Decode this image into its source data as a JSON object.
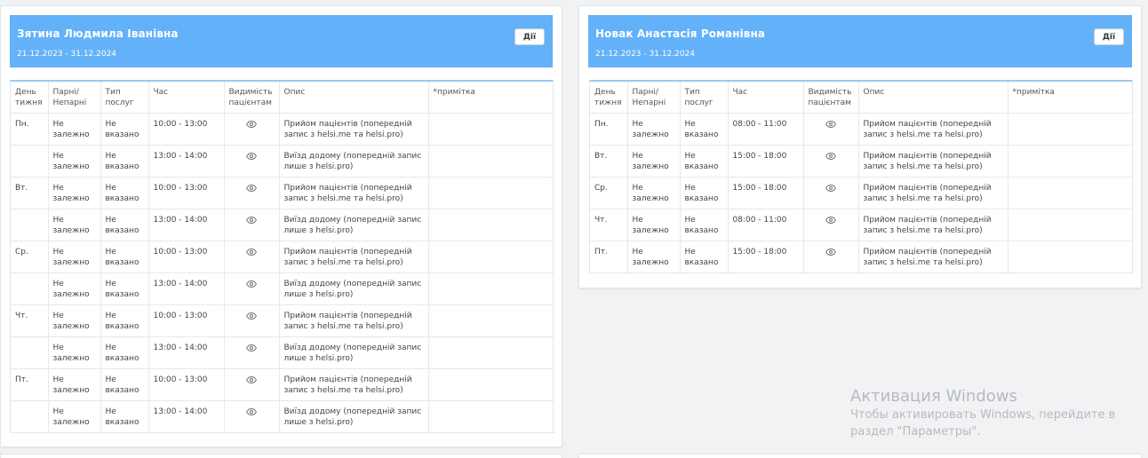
{
  "actions_label": "Дії",
  "eye_icon": "eye-icon",
  "columns": {
    "day": [
      "День",
      "тижня"
    ],
    "parity": [
      "Парні/",
      "Непарні"
    ],
    "service": [
      "Тип",
      "послуг"
    ],
    "time": "Час",
    "visibility": [
      "Видимість",
      "пацієнтам"
    ],
    "description": "Опис",
    "note": "*примітка"
  },
  "cards": [
    {
      "name": "Зятина Людмила Іванівна",
      "dates": "21.12.2023 - 31.12.2024",
      "rows": [
        {
          "day": "Пн.",
          "parity": [
            "Не",
            "залежно"
          ],
          "service": [
            "Не",
            "вказано"
          ],
          "time": "10:00 - 13:00",
          "desc": [
            "Прийом пацієнтів (попередній",
            "запис з helsi.me та helsi.pro)"
          ],
          "note": ""
        },
        {
          "day": "",
          "parity": [
            "Не",
            "залежно"
          ],
          "service": [
            "Не",
            "вказано"
          ],
          "time": "13:00 - 14:00",
          "desc": [
            "Виїзд додому (попередній запис",
            "лише з helsi.pro)"
          ],
          "note": ""
        },
        {
          "day": "Вт.",
          "parity": [
            "Не",
            "залежно"
          ],
          "service": [
            "Не",
            "вказано"
          ],
          "time": "10:00 - 13:00",
          "desc": [
            "Прийом пацієнтів (попередній",
            "запис з helsi.me та helsi.pro)"
          ],
          "note": ""
        },
        {
          "day": "",
          "parity": [
            "Не",
            "залежно"
          ],
          "service": [
            "Не",
            "вказано"
          ],
          "time": "13:00 - 14:00",
          "desc": [
            "Виїзд додому (попередній запис",
            "лише з helsi.pro)"
          ],
          "note": ""
        },
        {
          "day": "Ср.",
          "parity": [
            "Не",
            "залежно"
          ],
          "service": [
            "Не",
            "вказано"
          ],
          "time": "10:00 - 13:00",
          "desc": [
            "Прийом пацієнтів (попередній",
            "запис з helsi.me та helsi.pro)"
          ],
          "note": ""
        },
        {
          "day": "",
          "parity": [
            "Не",
            "залежно"
          ],
          "service": [
            "Не",
            "вказано"
          ],
          "time": "13:00 - 14:00",
          "desc": [
            "Виїзд додому (попередній запис",
            "лише з helsi.pro)"
          ],
          "note": ""
        },
        {
          "day": "Чт.",
          "parity": [
            "Не",
            "залежно"
          ],
          "service": [
            "Не",
            "вказано"
          ],
          "time": "10:00 - 13:00",
          "desc": [
            "Прийом пацієнтів (попередній",
            "запис з helsi.me та helsi.pro)"
          ],
          "note": ""
        },
        {
          "day": "",
          "parity": [
            "Не",
            "залежно"
          ],
          "service": [
            "Не",
            "вказано"
          ],
          "time": "13:00 - 14:00",
          "desc": [
            "Виїзд додому (попередній запис",
            "лише з helsi.pro)"
          ],
          "note": ""
        },
        {
          "day": "Пт.",
          "parity": [
            "Не",
            "залежно"
          ],
          "service": [
            "Не",
            "вказано"
          ],
          "time": "10:00 - 13:00",
          "desc": [
            "Прийом пацієнтів (попередній",
            "запис з helsi.me та helsi.pro)"
          ],
          "note": ""
        },
        {
          "day": "",
          "parity": [
            "Не",
            "залежно"
          ],
          "service": [
            "Не",
            "вказано"
          ],
          "time": "13:00 - 14:00",
          "desc": [
            "Виїзд додому (попередній запис",
            "лише з helsi.pro)"
          ],
          "note": ""
        }
      ]
    },
    {
      "name": "Новак Анастасія Романівна",
      "dates": "21.12.2023 - 31.12.2024",
      "rows": [
        {
          "day": "Пн.",
          "parity": [
            "Не",
            "залежно"
          ],
          "service": [
            "Не",
            "вказано"
          ],
          "time": "08:00 - 11:00",
          "desc": [
            "Прийом пацієнтів (попередній",
            "запис з helsi.me та helsi.pro)"
          ],
          "note": ""
        },
        {
          "day": "Вт.",
          "parity": [
            "Не",
            "залежно"
          ],
          "service": [
            "Не",
            "вказано"
          ],
          "time": "15:00 - 18:00",
          "desc": [
            "Прийом пацієнтів (попередній",
            "запис з helsi.me та helsi.pro)"
          ],
          "note": ""
        },
        {
          "day": "Ср.",
          "parity": [
            "Не",
            "залежно"
          ],
          "service": [
            "Не",
            "вказано"
          ],
          "time": "15:00 - 18:00",
          "desc": [
            "Прийом пацієнтів (попередній",
            "запис з helsi.me та helsi.pro)"
          ],
          "note": ""
        },
        {
          "day": "Чт.",
          "parity": [
            "Не",
            "залежно"
          ],
          "service": [
            "Не",
            "вказано"
          ],
          "time": "08:00 - 11:00",
          "desc": [
            "Прийом пацієнтів (попередній",
            "запис з helsi.me та helsi.pro)"
          ],
          "note": ""
        },
        {
          "day": "Пт.",
          "parity": [
            "Не",
            "залежно"
          ],
          "service": [
            "Не",
            "вказано"
          ],
          "time": "15:00 - 18:00",
          "desc": [
            "Прийом пацієнтів (попередній",
            "запис з helsi.me та helsi.pro)"
          ],
          "note": ""
        }
      ]
    }
  ],
  "watermark": {
    "title": "Активация Windows",
    "line1": "Чтобы активировать Windows, перейдите в",
    "line2": "раздел \"Параметры\"."
  }
}
